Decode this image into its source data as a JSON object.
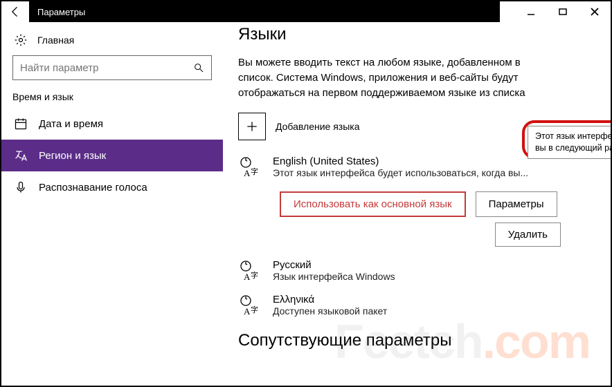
{
  "window": {
    "title": "Параметры"
  },
  "sidebar": {
    "home": "Главная",
    "search_placeholder": "Найти параметр",
    "section": "Время и язык",
    "items": [
      {
        "label": "Дата и время"
      },
      {
        "label": "Регион и язык"
      },
      {
        "label": "Распознавание голоса"
      }
    ]
  },
  "content": {
    "title": "Языки",
    "description": "Вы можете вводить текст на любом языке, добавленном в список. Система Windows, приложения и веб-сайты будут отображаться на первом поддерживаемом языке из списка",
    "add_language": "Добавление языка",
    "tooltip": "Этот язык интерфейса будет использоваться, когда вы в следующий раз войдете в систему",
    "languages": [
      {
        "name": "English (United States)",
        "sub": "Этот язык интерфейса будет использоваться, когда вы..."
      },
      {
        "name": "Русский",
        "sub": "Язык интерфейса Windows"
      },
      {
        "name": "Ελληνικά",
        "sub": "Доступен языковой пакет"
      }
    ],
    "actions": {
      "set_default": "Использовать как основной язык",
      "options": "Параметры",
      "remove": "Удалить"
    },
    "related_title": "Сопутствующие параметры"
  },
  "watermark": "Feetch.com"
}
